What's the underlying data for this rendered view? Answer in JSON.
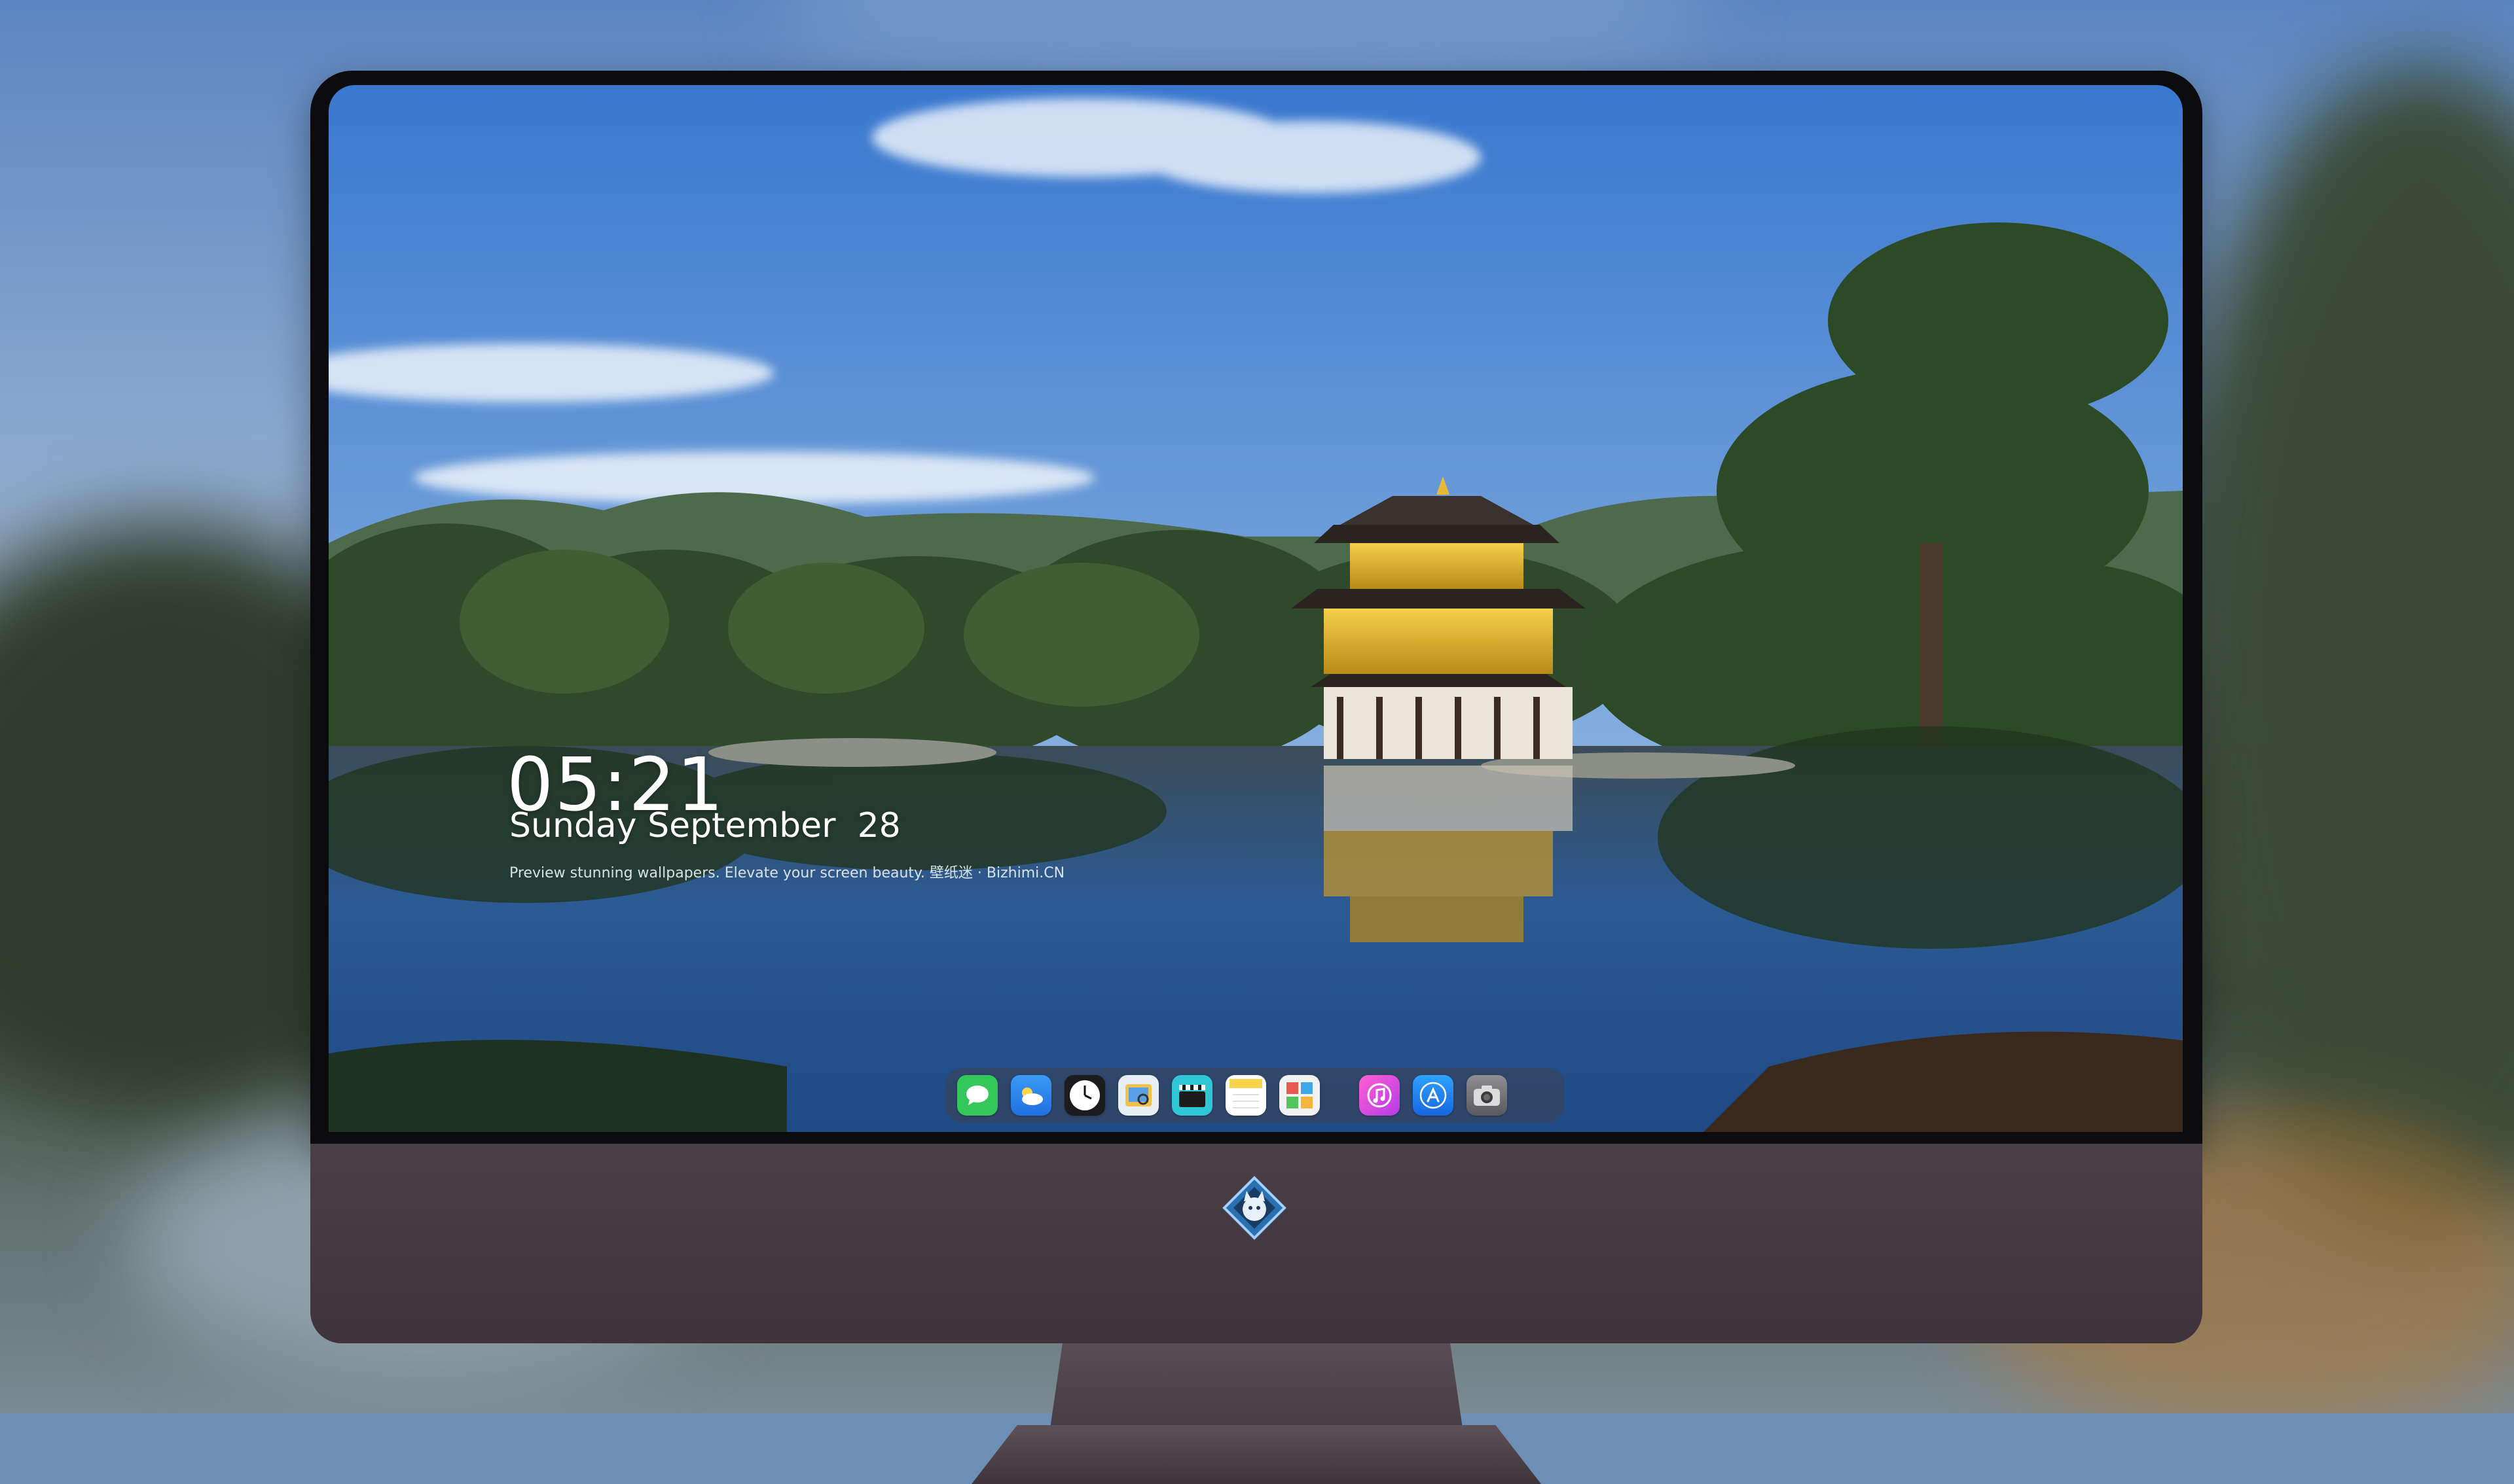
{
  "lock_screen": {
    "time": "05:21",
    "date": "Sunday September  28",
    "tagline": "Preview stunning wallpapers. Elevate your screen beauty. 壁纸迷 · Bizhimi.CN"
  },
  "dock": {
    "apps": [
      {
        "name": "messages-icon",
        "color": "#34c759"
      },
      {
        "name": "weather-icon",
        "color": "#2f8cf0"
      },
      {
        "name": "clock-icon",
        "color": "#ffffff"
      },
      {
        "name": "preview-icon",
        "color": "#f3c24a"
      },
      {
        "name": "final-cut-icon",
        "color": "#2fc7d6"
      },
      {
        "name": "notes-icon",
        "color": "#f7d24b"
      },
      {
        "name": "photo-booth-icon",
        "color": "#e85a4f"
      },
      {
        "name": "music-icon",
        "color": "#e03cd0"
      },
      {
        "name": "app-store-icon",
        "color": "#1e7cf2"
      },
      {
        "name": "camera-icon",
        "color": "#6e6e73"
      }
    ]
  },
  "monitor": {
    "logo": "fox-mascot-logo",
    "bezel_color": "#0c0c0e",
    "chin_color": "#45393f"
  }
}
